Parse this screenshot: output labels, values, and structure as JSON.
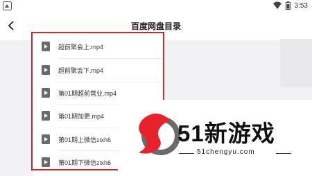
{
  "status_bar": {
    "time": "3:53"
  },
  "header": {
    "title": "百度网盘目录"
  },
  "files": [
    {
      "name": "超前聚会上.mp4"
    },
    {
      "name": "超前聚会下.mp4"
    },
    {
      "name": "第01期超前营业.mp4"
    },
    {
      "name": "第01期加更.mp4"
    },
    {
      "name": "第01期上微信zixh6"
    },
    {
      "name": "第01期下微信zixh6"
    }
  ],
  "watermark": {
    "title": "51新游戏",
    "url": "51chengyu.com"
  },
  "icons": {
    "back": "back-arrow-icon",
    "file": "video-file-icon",
    "wifi": "wifi-icon",
    "battery": "battery-icon"
  },
  "colors": {
    "highlight": "#d0262b",
    "brand_red": "#e8222a"
  }
}
